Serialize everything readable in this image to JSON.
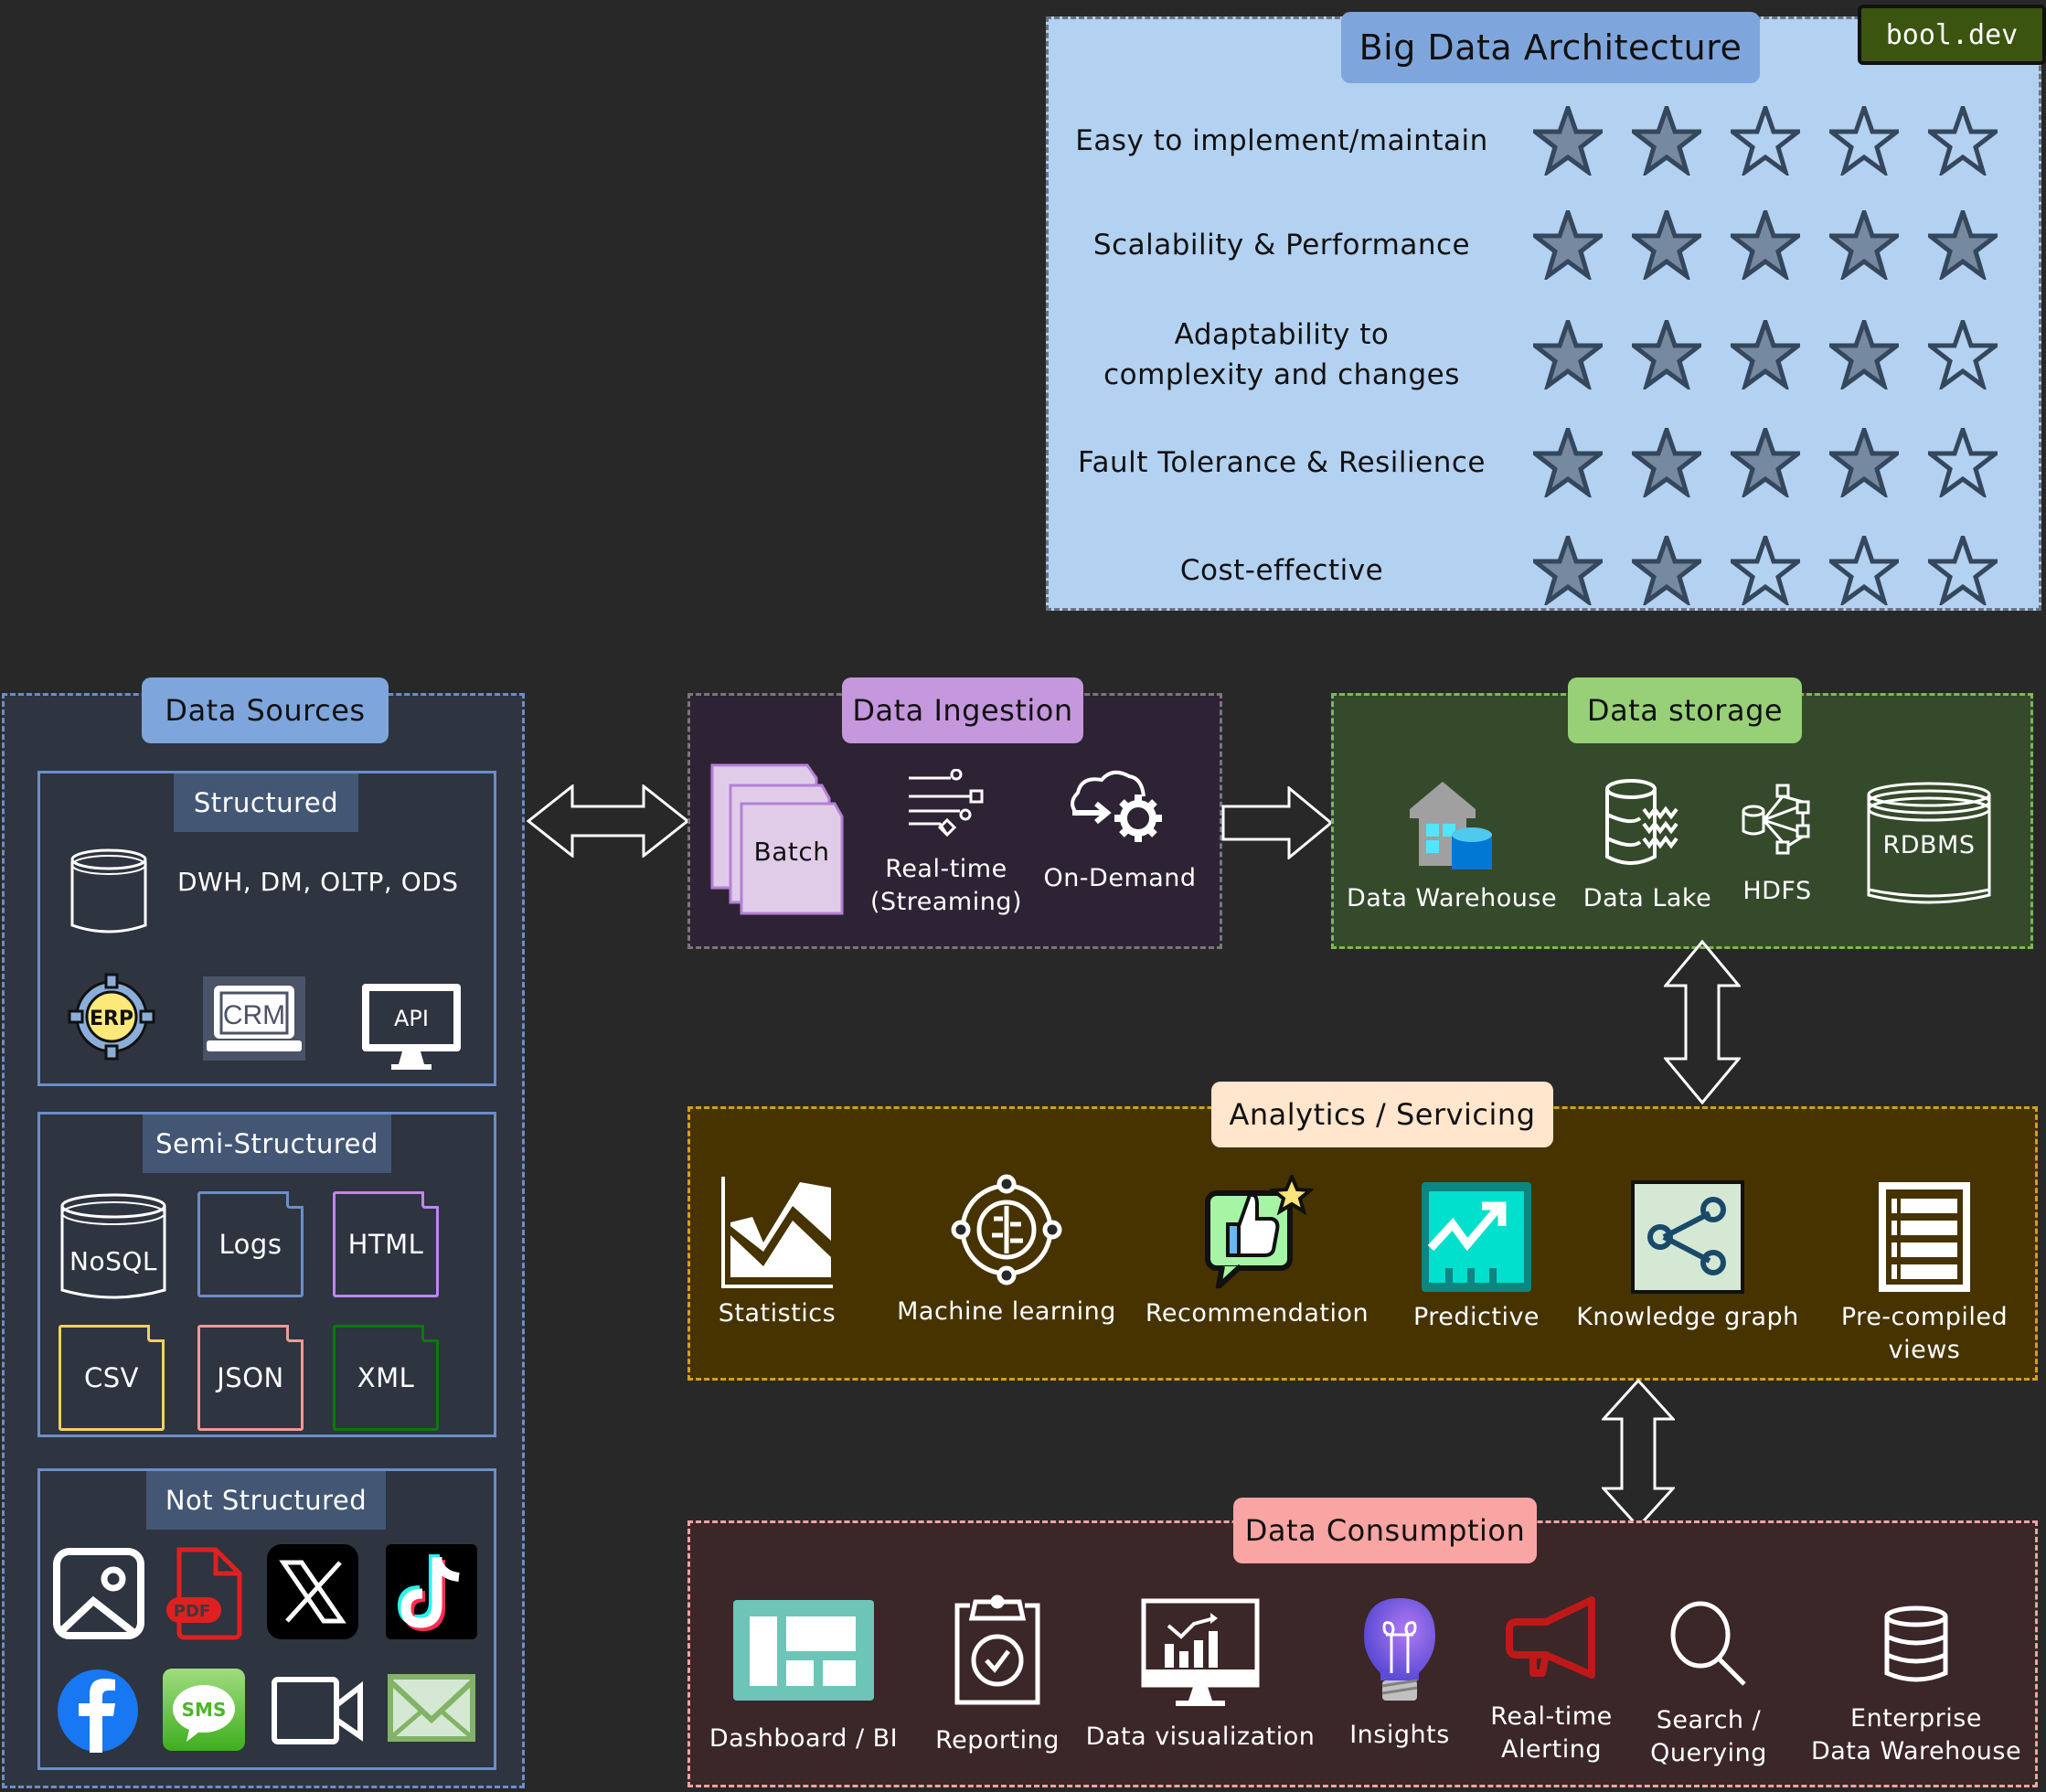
{
  "brand": "bool.dev",
  "rating_panel": {
    "title": "Big Data Architecture",
    "max_stars": 5,
    "criteria": [
      {
        "label": "Easy to implement/maintain",
        "rating": 2
      },
      {
        "label": "Scalability & Performance",
        "rating": 5
      },
      {
        "label": "Adaptability to complexity and changes",
        "rating": 4
      },
      {
        "label": "Fault Tolerance & Resilience",
        "rating": 4
      },
      {
        "label": "Cost-effective",
        "rating": 2
      }
    ]
  },
  "data_sources": {
    "title": "Data Sources",
    "structured": {
      "title": "Structured",
      "db_label": "DWH, DM, OLTP, ODS",
      "icons": [
        {
          "name": "erp-icon",
          "label": "ERP"
        },
        {
          "name": "crm-icon",
          "label": "CRM"
        },
        {
          "name": "api-icon",
          "label": "API"
        }
      ]
    },
    "semi_structured": {
      "title": "Semi-Structured",
      "items": [
        {
          "label": "NoSQL",
          "color": "#ffffff"
        },
        {
          "label": "Logs",
          "color": "#6a8ec8"
        },
        {
          "label": "HTML",
          "color": "#c085f0"
        },
        {
          "label": "CSV",
          "color": "#f5d061"
        },
        {
          "label": "JSON",
          "color": "#ef9a94"
        },
        {
          "label": "XML",
          "color": "#0a7a0a"
        }
      ]
    },
    "not_structured": {
      "title": "Not Structured",
      "icons": [
        "image-icon",
        "pdf-icon",
        "x-logo-icon",
        "tiktok-icon",
        "facebook-icon",
        "sms-icon",
        "video-icon",
        "email-icon"
      ],
      "pdf_label": "PDF",
      "sms_label": "SMS"
    }
  },
  "data_ingestion": {
    "title": "Data Ingestion",
    "items": [
      {
        "label": "Batch"
      },
      {
        "label": "Real-time",
        "label2": "(Streaming)"
      },
      {
        "label": "On-Demand"
      }
    ]
  },
  "data_storage": {
    "title": "Data storage",
    "items": [
      {
        "label": "Data Warehouse"
      },
      {
        "label": "Data Lake"
      },
      {
        "label": "HDFS"
      },
      {
        "label": "RDBMS"
      }
    ]
  },
  "analytics": {
    "title": "Analytics / Servicing",
    "items": [
      {
        "label": "Statistics"
      },
      {
        "label": "Machine learning"
      },
      {
        "label": "Recommendation"
      },
      {
        "label": "Predictive"
      },
      {
        "label": "Knowledge graph"
      },
      {
        "label": "Pre-compiled",
        "label2": "views"
      }
    ]
  },
  "consumption": {
    "title": "Data Consumption",
    "items": [
      {
        "label": "Dashboard / BI"
      },
      {
        "label": "Reporting"
      },
      {
        "label": "Data visualization"
      },
      {
        "label": "Insights"
      },
      {
        "label": "Real-time",
        "label2": "Alerting"
      },
      {
        "label": "Search /",
        "label2": "Querying"
      },
      {
        "label": "Enterprise",
        "label2": "Data Warehouse"
      }
    ]
  },
  "colors": {
    "background": "#282828",
    "rating_panel": "#b3d1f0",
    "star_filled": "#7589a0",
    "star_outline": "#34475c",
    "sources_accent": "#7ea6dc",
    "ingestion_accent": "#c597dc",
    "storage_accent": "#97d077",
    "analytics_accent": "#ffe6cc",
    "consumption_accent": "#f8a5a3"
  }
}
